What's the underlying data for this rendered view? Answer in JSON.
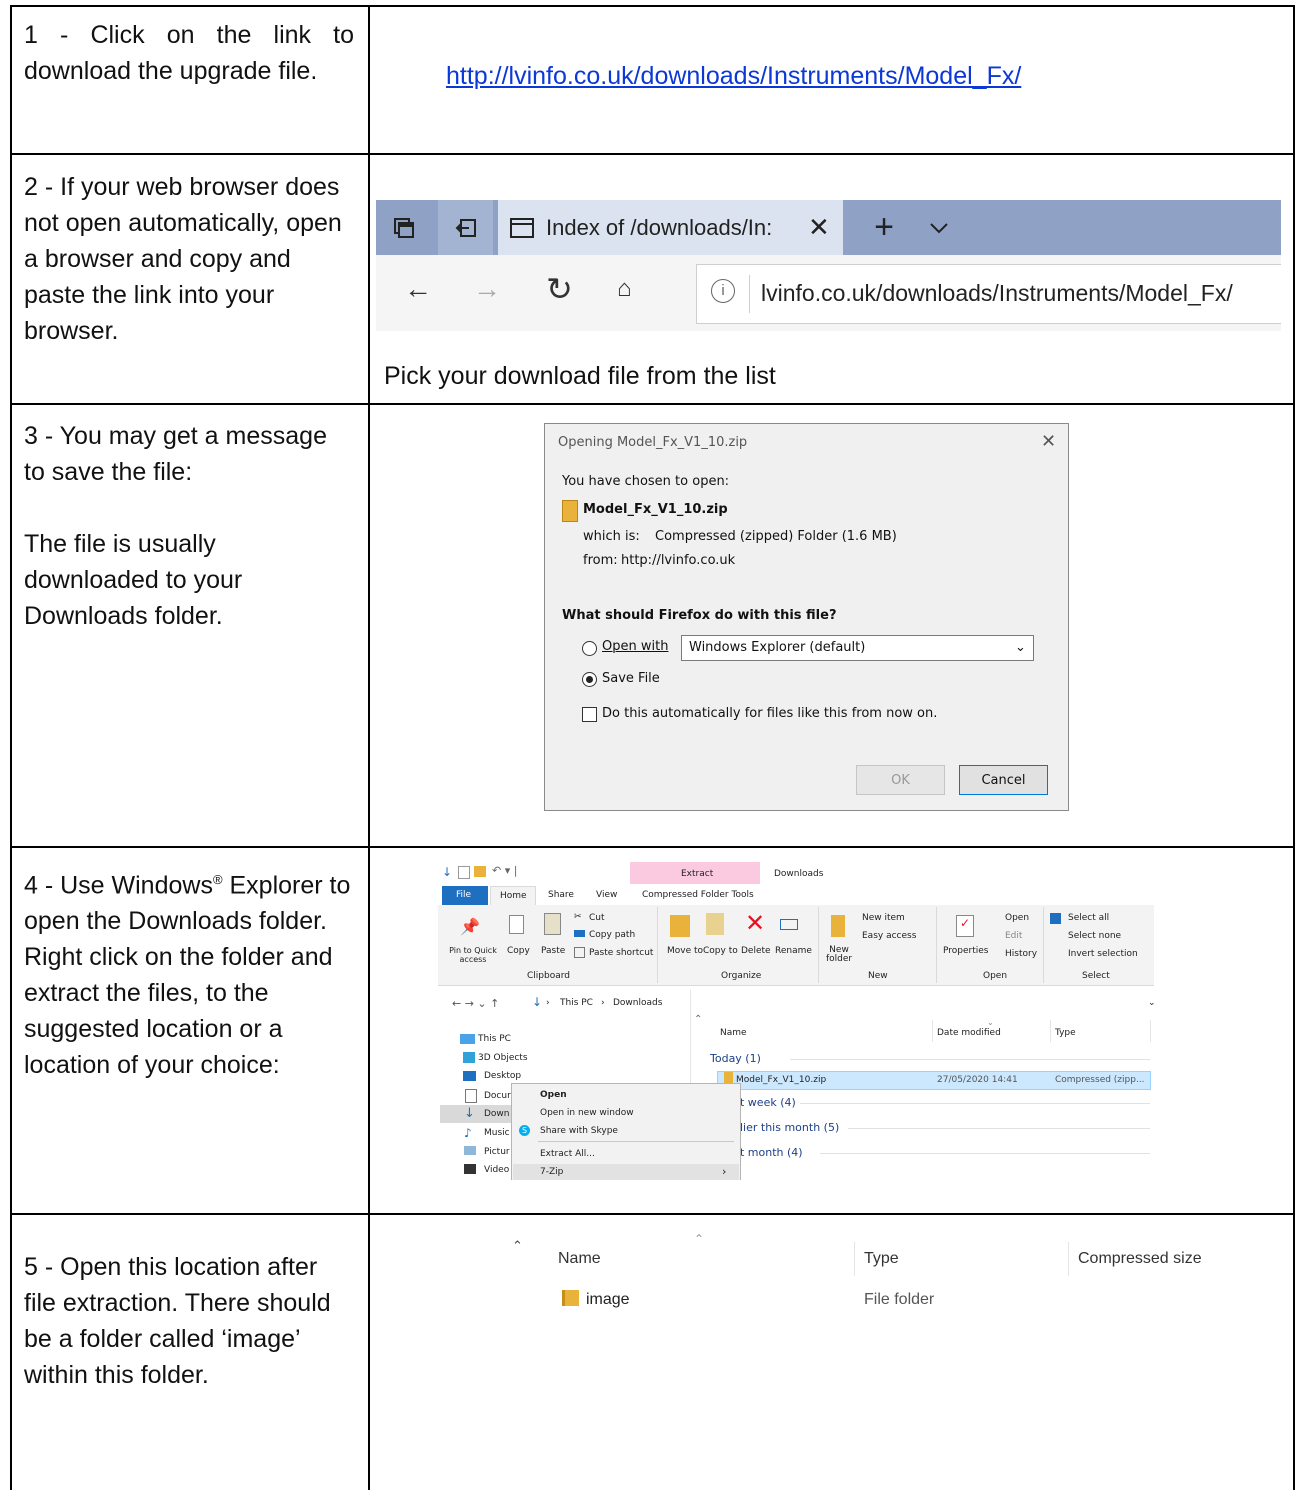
{
  "steps": [
    {
      "text": "1 -  Click on the link to download the upgrade file."
    },
    {
      "text": "2 -  If your web browser does not open automatically, open a browser and copy and paste the link into your browser."
    },
    {
      "text": "3 -  You may get a message to save the file:",
      "note": "The file is usually downloaded to your Downloads folder."
    },
    {
      "text_before": "4 -  Use Windows",
      "text_sup": "®",
      "text_after": " Explorer to open the Downloads folder. Right click on the folder and extract the files, to the suggested location or a location of your choice:"
    },
    {
      "text": "5 -  Open this location after file extraction. There should be a folder called ‘image’ within this folder."
    }
  ],
  "download_link": "http://lvinfo.co.uk/downloads/Instruments/Model_Fx/",
  "browser": {
    "tab_title": "Index of /downloads/In:",
    "address": "lvinfo.co.uk/downloads/Instruments/Model_Fx/",
    "icons": [
      "tab-preview-icon",
      "set-aside-icon",
      "tab-page-icon",
      "close-icon",
      "new-tab-icon",
      "chevron-down-icon",
      "back-icon",
      "forward-icon",
      "refresh-icon",
      "home-icon",
      "info-icon"
    ]
  },
  "pick_text": "Pick your download file from the list",
  "dialog": {
    "title": "Opening Model_Fx_V1_10.zip",
    "chosen": "You have chosen to open:",
    "filename": "Model_Fx_V1_10.zip",
    "which_label": "which is:",
    "which_value": "Compressed (zipped) Folder (1.6 MB)",
    "from_label": "from:",
    "from_value": "http://lvinfo.co.uk",
    "question": "What should Firefox do with this file?",
    "open_with": "Open with",
    "open_with_app": "Windows Explorer (default)",
    "save_file": "Save File",
    "auto": "Do this automatically for files like this from now on.",
    "ok": "OK",
    "cancel": "Cancel"
  },
  "explorer": {
    "extract_tab": "Extract",
    "window_title": "Downloads",
    "tabs": [
      "File",
      "Home",
      "Share",
      "View"
    ],
    "tools_tab": "Compressed Folder Tools",
    "clipboard": {
      "pin": "Pin to Quick access",
      "copy": "Copy",
      "paste": "Paste",
      "cut": "Cut",
      "copy_path": "Copy path",
      "paste_shortcut": "Paste shortcut",
      "group": "Clipboard"
    },
    "organize": {
      "move": "Move to",
      "copy": "Copy to",
      "delete": "Delete",
      "rename": "Rename",
      "group": "Organize"
    },
    "new": {
      "folder": "New folder",
      "item": "New item",
      "easy": "Easy access",
      "group": "New"
    },
    "open": {
      "properties": "Properties",
      "open": "Open",
      "edit": "Edit",
      "history": "History",
      "group": "Open"
    },
    "select": {
      "all": "Select all",
      "none": "Select none",
      "invert": "Invert selection",
      "group": "Select"
    },
    "breadcrumb": [
      "This PC",
      "Downloads"
    ],
    "nav": [
      "This PC",
      "3D Objects",
      "Desktop",
      "Docur",
      "Down",
      "Music",
      "Pictur",
      "Video"
    ],
    "columns": [
      "Name",
      "Date modified",
      "Type"
    ],
    "groups": [
      "Today (1)",
      "t week (4)",
      "lier this month (5)",
      "t month (4)"
    ],
    "file": {
      "name": "Model_Fx_V1_10.zip",
      "date": "27/05/2020 14:41",
      "type": "Compressed (zipp..."
    },
    "context_menu": [
      "Open",
      "Open in new window",
      "Share with Skype",
      "Extract All...",
      "7-Zip"
    ]
  },
  "extracted": {
    "columns": [
      "Name",
      "Type",
      "Compressed size"
    ],
    "row": {
      "name": "image",
      "type": "File folder"
    }
  },
  "colors": {
    "link": "#0b38d6",
    "tabbar": "#8fa2c6",
    "selection": "#cce8ff",
    "extract_tab": "#fbc9e0",
    "file_tab": "#1f6fc1",
    "delete_red": "#e81123"
  }
}
